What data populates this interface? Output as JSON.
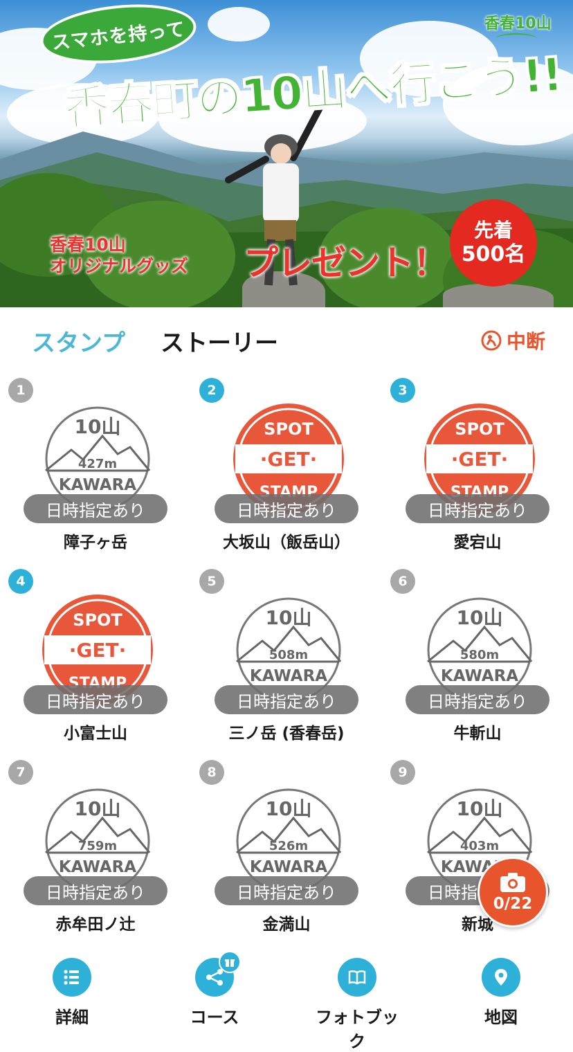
{
  "banner": {
    "callout": "スマホを持って",
    "headline": "香春町の10山へ行こう!!",
    "logo": "香春10山",
    "goods_line1": "香春10山",
    "goods_line2": "オリジナルグッズ",
    "present": "プレゼント！",
    "badge_line1": "先着",
    "badge_line2": "500名"
  },
  "tabs": {
    "stamp": "スタンプ",
    "story": "ストーリー",
    "pause": "中断"
  },
  "pill_text": "日時指定あり",
  "stamp_texts": {
    "top": "10山",
    "bottom": "KAWARA",
    "spot": "SPOT",
    "get": "·GET·",
    "stamp": "STAMP"
  },
  "mountains": [
    {
      "num": "1",
      "name": "障子ヶ岳",
      "elevation": "427m",
      "obtained": false
    },
    {
      "num": "2",
      "name": "大坂山（飯岳山）",
      "elevation": "",
      "obtained": true
    },
    {
      "num": "3",
      "name": "愛宕山",
      "elevation": "",
      "obtained": true
    },
    {
      "num": "4",
      "name": "小富士山",
      "elevation": "",
      "obtained": true
    },
    {
      "num": "5",
      "name": "三ノ岳 (香春岳)",
      "elevation": "508m",
      "obtained": false
    },
    {
      "num": "6",
      "name": "牛斬山",
      "elevation": "580m",
      "obtained": false
    },
    {
      "num": "7",
      "name": "赤牟田ノ辻",
      "elevation": "759m",
      "obtained": false
    },
    {
      "num": "8",
      "name": "金満山",
      "elevation": "526m",
      "obtained": false
    },
    {
      "num": "9",
      "name": "新城",
      "elevation": "403m",
      "obtained": false
    }
  ],
  "camera": {
    "count": "0/22",
    "icon": "camera-icon"
  },
  "nav": [
    {
      "label": "詳細",
      "icon": "list-icon"
    },
    {
      "label": "コース",
      "icon": "share-icon"
    },
    {
      "label": "フォトブック",
      "icon": "book-icon"
    },
    {
      "label": "地図",
      "icon": "map-pin-icon"
    }
  ],
  "colors": {
    "accent": "#2eb1d9",
    "stamp_red": "#e8573a",
    "pause_orange": "#e8542c",
    "inactive_gray": "#a8a8a8",
    "banner_green": "#42b333",
    "banner_red": "#e8342c"
  }
}
